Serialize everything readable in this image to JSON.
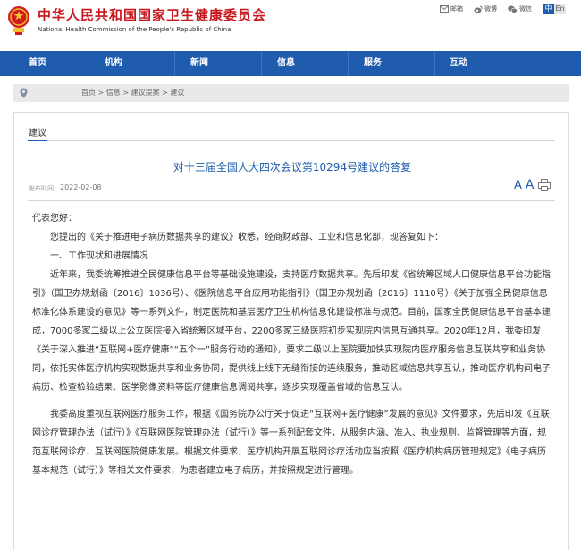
{
  "header": {
    "site_name_cn": "中华人民共和国国家卫生健康委员会",
    "site_name_en": "National Health Commission of the People's Republic of China",
    "top_links": [
      {
        "label": "邮箱",
        "icon": "mail-icon"
      },
      {
        "label": "微博",
        "icon": "weibo-icon"
      },
      {
        "label": "微信",
        "icon": "wechat-icon"
      }
    ],
    "lang_cn": "中",
    "lang_en": "En"
  },
  "nav": {
    "items": [
      "首页",
      "机构",
      "新闻",
      "信息",
      "服务",
      "互动"
    ]
  },
  "breadcrumb": {
    "text": "首页 > 信息 > 建议提案 > 建议"
  },
  "article": {
    "section": "建议",
    "title": "对十三届全国人大四次会议第10294号建议的答复",
    "date_label": "发布时间：",
    "date": "2022-02-08",
    "font_large": "A",
    "font_small": "A",
    "paragraphs": [
      "代表您好：",
      "您提出的《关于推进电子病历数据共享的建议》收悉，经商财政部、工业和信息化部，现答复如下：",
      "一、工作现状和进展情况",
      "近年来，我委统筹推进全民健康信息平台等基础设施建设，支持医疗数据共享。先后印发《省统筹区域人口健康信息平台功能指引》（国卫办规划函〔2016〕1036号）、《医院信息平台应用功能指引》（国卫办规划函〔2016〕1110号）《关于加强全民健康信息标准化体系建设的意见》等一系列文件，制定医院和基层医疗卫生机构信息化建设标准与规范。目前，国家全民健康信息平台基本建成，7000多家二级以上公立医院接入省统筹区域平台，2200多家三级医院初步实现院内信息互通共享。2020年12月，我委印发《关于深入推进“互联网+医疗健康”“五个一”服务行动的通知》，要求二级以上医院要加快实现院内医疗服务信息互联共享和业务协同，依托实体医疗机构实现数据共享和业务协同，提供线上线下无缝衔接的连续服务，推动区域信息共享互认，推动医疗机构间电子病历、检查检验结果、医学影像资料等医疗健康信息调阅共享，逐步实现覆盖省域的信息互认。",
      "我委高度重视互联网医疗服务工作，根据《国务院办公厅关于促进“互联网+医疗健康”发展的意见》文件要求，先后印发《互联网诊疗管理办法（试行）》《互联网医院管理办法（试行）》等一系列配套文件，从服务内涵、准入、执业规则、监督管理等方面，规范互联网诊疗、互联网医院健康发展。根据文件要求，医疗机构开展互联网诊疗活动应当按照《医疗机构病历管理规定》《电子病历基本规范（试行）》等相关文件要求，为患者建立电子病历，并按照规定进行管理。"
    ]
  },
  "colors": {
    "brand_red": "#c8161d",
    "nav_blue": "#1f5cad",
    "title_blue": "#1f5cad"
  }
}
